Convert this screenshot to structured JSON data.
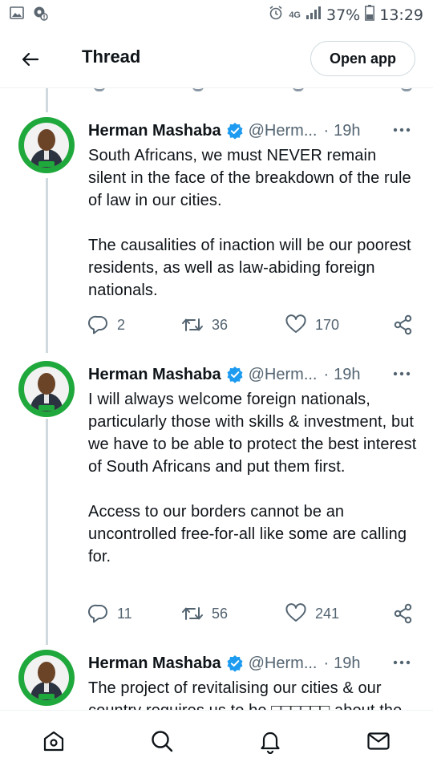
{
  "status_bar": {
    "network": "4G",
    "battery": "37%",
    "time": "13:29"
  },
  "header": {
    "title": "Thread",
    "open_app_label": "Open app"
  },
  "tweets": [
    {
      "name": "Herman Mashaba",
      "handle": "@Herm...",
      "dot": "·",
      "time": "19h",
      "text": "South Africans, we must NEVER remain silent in the face of the breakdown of the rule of law in our cities.\n\nThe causalities of inaction will be our poorest residents, as well as law-abiding foreign nationals.",
      "replies": "2",
      "retweets": "36",
      "likes": "170"
    },
    {
      "name": "Herman Mashaba",
      "handle": "@Herm...",
      "dot": "·",
      "time": "19h",
      "text": "I will always welcome foreign nationals, particularly those with skills & investment, but we have to be able to protect the best interest of South Africans and put them first.\n\nAccess to our borders cannot be an uncontrolled free-for-all like some are calling for.",
      "replies": "11",
      "retweets": "56",
      "likes": "241"
    },
    {
      "name": "Herman Mashaba",
      "handle": "@Herm...",
      "dot": "·",
      "time": "19h",
      "text": "The project of revitalising our cities & our country requires us to be □□□□□□ about the"
    }
  ],
  "icons": {
    "accent": "#1d9bf0",
    "muted": "#536471"
  }
}
